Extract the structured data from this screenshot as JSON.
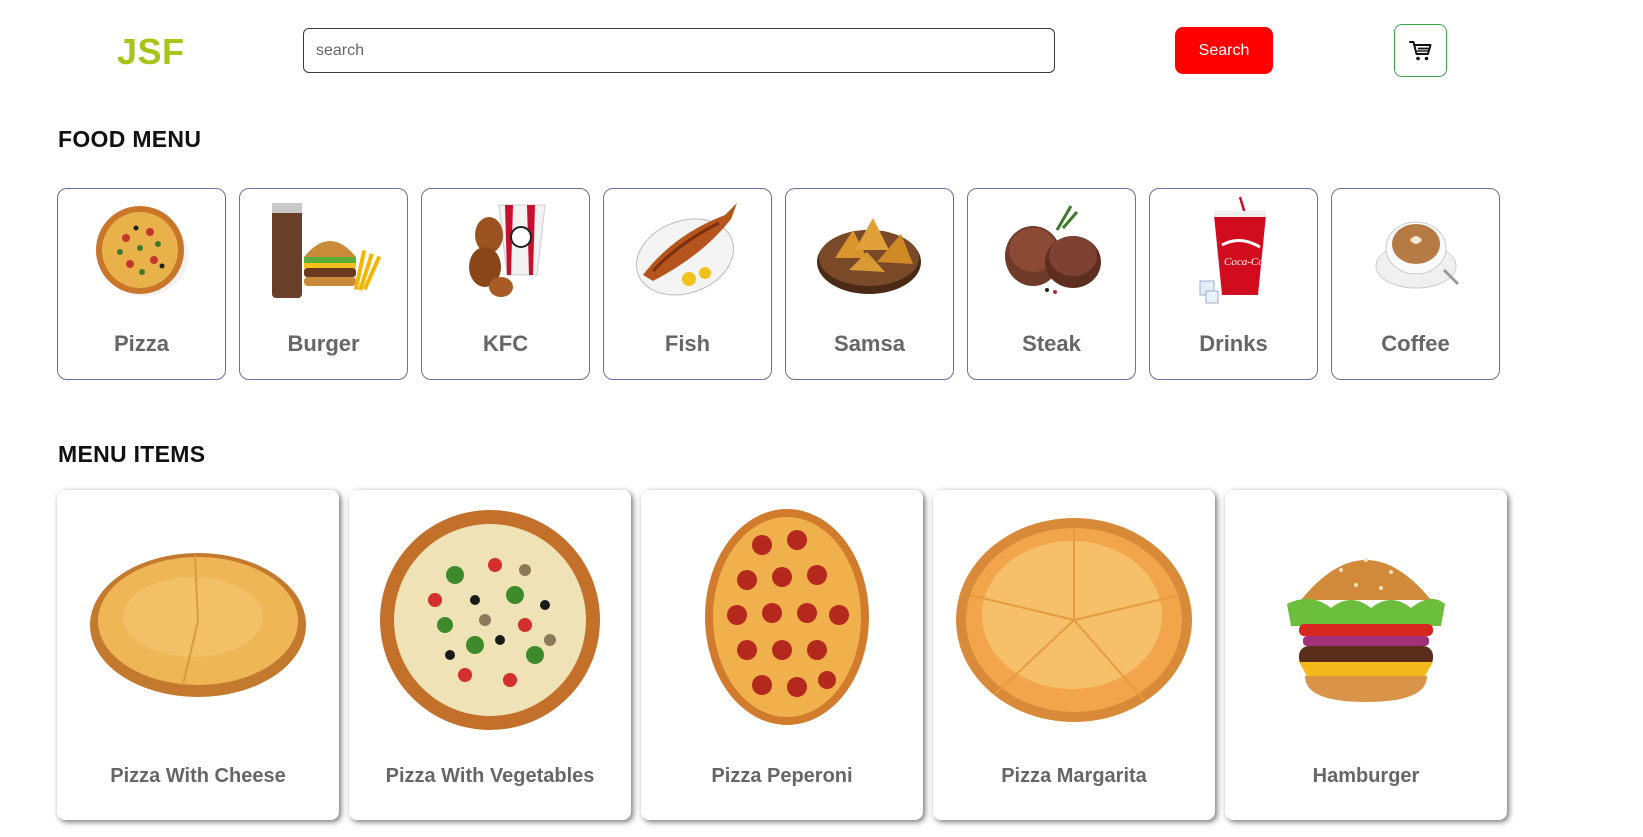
{
  "header": {
    "logo": "JSF",
    "search": {
      "placeholder": "search",
      "value": ""
    },
    "search_button": "Search",
    "cart_icon": "cart-icon"
  },
  "colors": {
    "logo": "#a8c41a",
    "search_button": "#ff0000",
    "cart_border": "#3aa44a",
    "category_border": "#6c6ca8"
  },
  "food_menu": {
    "title": "FOOD MENU",
    "categories": [
      {
        "label": "Pizza",
        "icon": "pizza-image"
      },
      {
        "label": "Burger",
        "icon": "burger-image"
      },
      {
        "label": "KFC",
        "icon": "kfc-chicken-image"
      },
      {
        "label": "Fish",
        "icon": "fish-image"
      },
      {
        "label": "Samsa",
        "icon": "samsa-image"
      },
      {
        "label": "Steak",
        "icon": "steak-image"
      },
      {
        "label": "Drinks",
        "icon": "drinks-image"
      },
      {
        "label": "Coffee",
        "icon": "coffee-image"
      }
    ]
  },
  "menu_items": {
    "title": "MENU ITEMS",
    "items": [
      {
        "name": "Pizza With Cheese",
        "icon": "cheese-pizza-image"
      },
      {
        "name": "Pizza With Vegetables",
        "icon": "vegetable-pizza-image"
      },
      {
        "name": "Pizza Peperoni",
        "icon": "pepperoni-pizza-image"
      },
      {
        "name": "Pizza Margarita",
        "icon": "margarita-pizza-image"
      },
      {
        "name": "Hamburger",
        "icon": "hamburger-image"
      }
    ]
  }
}
